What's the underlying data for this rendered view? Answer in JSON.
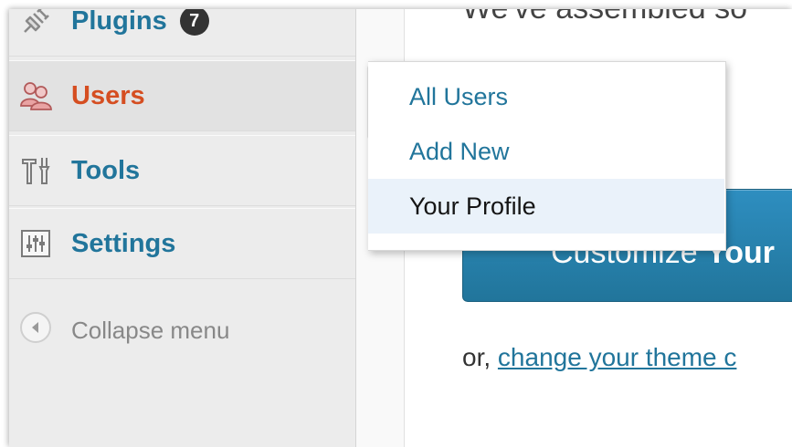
{
  "sidebar": {
    "items": [
      {
        "label": "Plugins",
        "icon": "plugin-icon",
        "badge": "7",
        "current": false
      },
      {
        "label": "Users",
        "icon": "users-icon",
        "current": true
      },
      {
        "label": "Tools",
        "icon": "tools-icon",
        "current": false
      },
      {
        "label": "Settings",
        "icon": "settings-icon",
        "current": false
      }
    ],
    "collapse_label": "Collapse menu",
    "collapse_icon": "collapse-arrow-icon"
  },
  "submenu": {
    "items": [
      {
        "label": "All Users"
      },
      {
        "label": "Add New"
      },
      {
        "label": "Your Profile",
        "hover": true
      }
    ]
  },
  "main": {
    "intro_text": "We've assembled so",
    "cta_part1": "Customize",
    "cta_part2": "Your",
    "alt_prefix": "or,",
    "alt_link": "change your theme c"
  },
  "colors": {
    "link": "#21759b",
    "current": "#d54e21",
    "cta": "#21759b",
    "hover_bg": "#eaf2fa"
  }
}
